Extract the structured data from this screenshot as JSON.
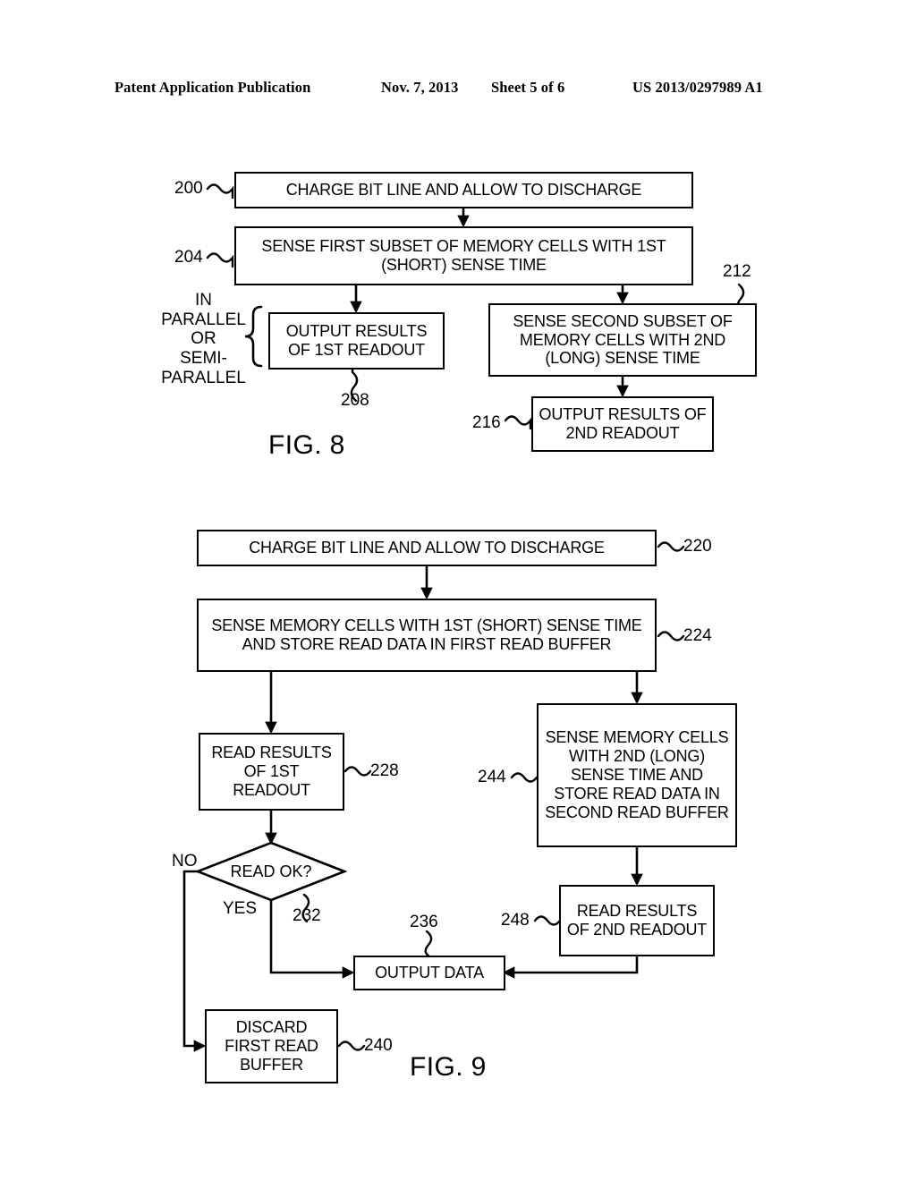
{
  "header": {
    "publication": "Patent Application Publication",
    "date": "Nov. 7, 2013",
    "sheet": "Sheet 5 of 6",
    "patent_number": "US 2013/0297989 A1"
  },
  "figures": [
    {
      "caption": "FIG. 8",
      "annotation": "IN\nPARALLEL\nOR\nSEMI-\nPARALLEL",
      "nodes": [
        {
          "ref": "200",
          "text": "CHARGE BIT LINE AND ALLOW TO DISCHARGE"
        },
        {
          "ref": "204",
          "text": "SENSE FIRST SUBSET OF MEMORY CELLS WITH 1ST (SHORT) SENSE TIME"
        },
        {
          "ref": "208",
          "text": "OUTPUT RESULTS OF 1ST READOUT"
        },
        {
          "ref": "212",
          "text": "SENSE SECOND SUBSET OF MEMORY CELLS WITH 2ND (LONG) SENSE TIME"
        },
        {
          "ref": "216",
          "text": "OUTPUT RESULTS OF 2ND READOUT"
        }
      ]
    },
    {
      "caption": "FIG. 9",
      "nodes": [
        {
          "ref": "220",
          "text": "CHARGE BIT LINE AND ALLOW TO DISCHARGE"
        },
        {
          "ref": "224",
          "text": "SENSE MEMORY CELLS WITH 1ST (SHORT) SENSE TIME AND STORE READ DATA IN FIRST READ BUFFER"
        },
        {
          "ref": "228",
          "text": "READ RESULTS OF 1ST READOUT"
        },
        {
          "ref": "232",
          "text": "READ OK?"
        },
        {
          "ref": "236",
          "text": "OUTPUT DATA"
        },
        {
          "ref": "240",
          "text": "DISCARD FIRST READ BUFFER"
        },
        {
          "ref": "244",
          "text": "SENSE MEMORY CELLS WITH 2ND (LONG) SENSE TIME AND STORE READ DATA IN SECOND READ BUFFER"
        },
        {
          "ref": "248",
          "text": "READ RESULTS OF 2ND READOUT"
        }
      ],
      "branch_labels": {
        "no": "NO",
        "yes": "YES"
      }
    }
  ]
}
